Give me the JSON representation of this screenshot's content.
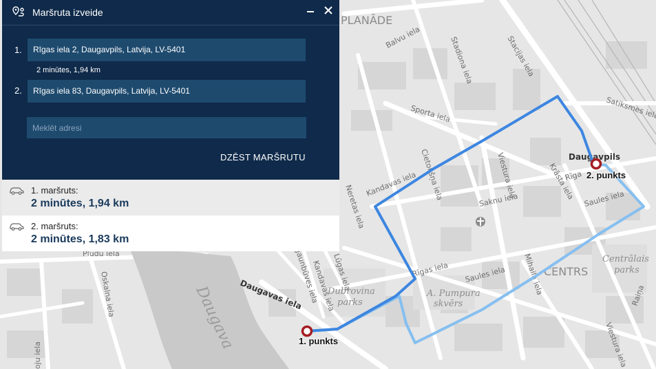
{
  "panel": {
    "title": "Maršruta izveide",
    "stops": [
      {
        "index": "1.",
        "address": "Rīgas iela 2, Daugavpils, Latvija, LV-5401"
      },
      {
        "index": "2.",
        "address": "Rīgas iela 83, Daugavpils, Latvija, LV-5401"
      }
    ],
    "segment_info": "2 minūtes, 1,94 km",
    "search_placeholder": "Meklēt adresi",
    "clear_label": "DZĒST MARŠRUTU",
    "icons": {
      "route": "route-pin-icon",
      "minimize": "minimize-icon",
      "close": "close-icon",
      "car": "car-icon"
    }
  },
  "routes": [
    {
      "name": "1. maršruts:",
      "value": "2 minūtes, 1,94 km",
      "color": "#3d86e0"
    },
    {
      "name": "2. maršruts:",
      "value": "2 minūtes, 1,83 km",
      "color": "#86bff0"
    }
  ],
  "map": {
    "labels": {
      "planade": "PLANĀDE",
      "centrs": "CENTRS",
      "balvu": "Balvu iela",
      "stadiona": "Stadiona iela",
      "stacijas": "Stacijas iela",
      "sporta": "Sporta iela",
      "satiksmes": "Satiksmes iela",
      "cietoksna": "Cietokšņa iela",
      "kandavas": "Kandavas iela",
      "viestura": "Viestura iela",
      "saknu": "Saknu iela",
      "krasta": "Krāsta iela",
      "rigas_e": "Rīga",
      "saules_e": "Saules iela",
      "daugavpils": "Daugavpils",
      "rigas_c": "Rīgas iela",
      "saules_c": "Saules iela",
      "mihaila": "Mihaila iela",
      "centralais": "Centrālais",
      "parks": "parks",
      "raina": "Raiņa",
      "viestura_s": "Viestura iela",
      "dubrovina": "Dubrovina",
      "dubrovina_parks": "parks",
      "rampura": "A. Pumpura",
      "skvers": "skvērs",
      "daugavas": "Daugavas iela",
      "daugava": "Daugava",
      "pludu": "Plūdu iela",
      "oskalna": "Oskalna iela",
      "jaunbuves": "Jaunbūves iela",
      "kandavas_s": "Kandavas iela",
      "luga": "Lūgas iela",
      "neretas": "Neretas iela",
      "ojuiela": "oju iela"
    },
    "pins": [
      {
        "label": "1. punkts",
        "color": "#a31d22"
      },
      {
        "label": "2. punkts",
        "color": "#a31d22"
      }
    ]
  }
}
